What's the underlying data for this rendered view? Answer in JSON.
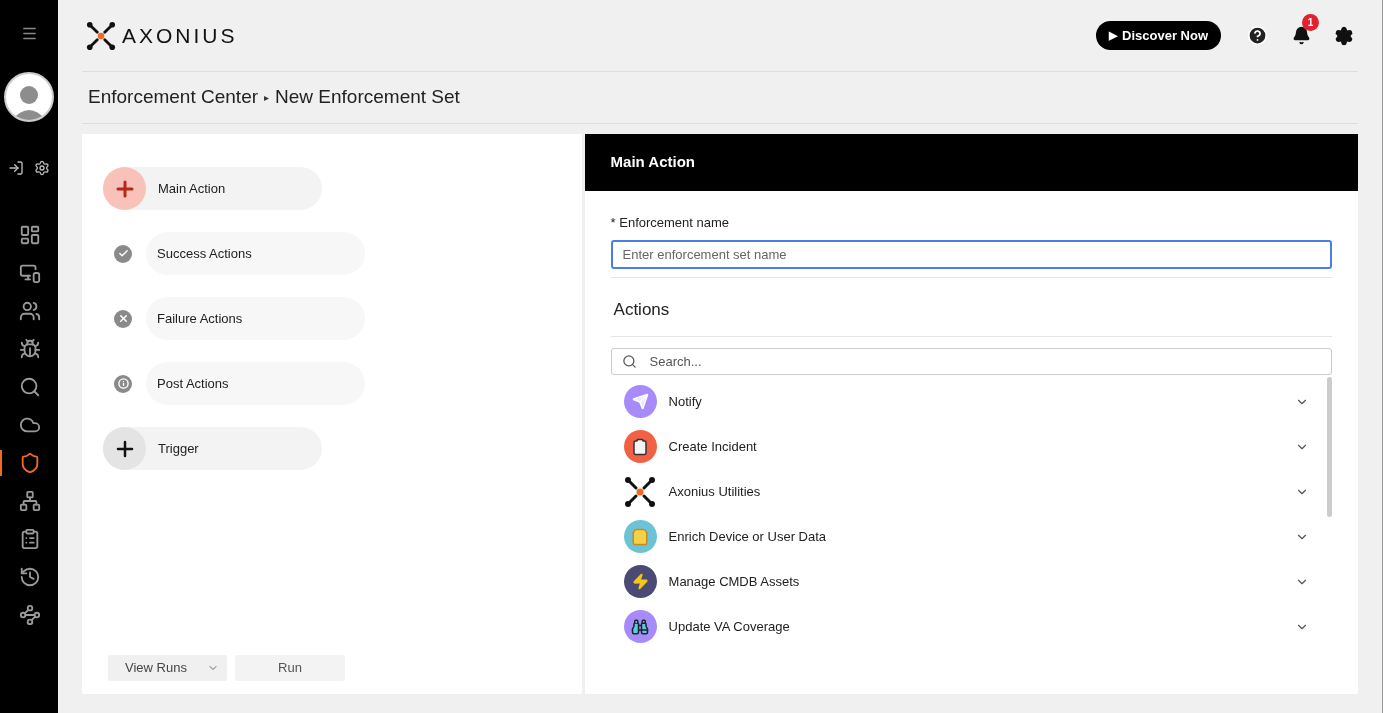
{
  "sidebar": {
    "nav": [
      {
        "selected": false
      },
      {
        "selected": false
      },
      {
        "selected": false
      },
      {
        "selected": false
      },
      {
        "selected": false
      },
      {
        "selected": false
      },
      {
        "selected": true
      },
      {
        "selected": false
      },
      {
        "selected": false
      },
      {
        "selected": false
      },
      {
        "selected": false
      }
    ]
  },
  "header": {
    "logo": "AXONIUS",
    "discover_button": "Discover Now",
    "play_glyph": "▶",
    "notification_count": "1"
  },
  "breadcrumb": {
    "parent": "Enforcement Center",
    "separator": "▸",
    "current": "New Enforcement Set"
  },
  "steps": [
    {
      "kind": "add",
      "label": "Main Action",
      "selected": true
    },
    {
      "kind": "success",
      "label": "Success Actions",
      "selected": false
    },
    {
      "kind": "failure",
      "label": "Failure Actions",
      "selected": false
    },
    {
      "kind": "info",
      "label": "Post Actions",
      "selected": false
    },
    {
      "kind": "add",
      "label": "Trigger",
      "selected": false
    }
  ],
  "footer_buttons": {
    "view_runs": "View Runs",
    "run": "Run"
  },
  "panel": {
    "title": "Main Action",
    "name_label": "* Enforcement name",
    "name_placeholder": "Enter enforcement set name",
    "actions_heading": "Actions",
    "search_placeholder": "Search...",
    "actions": [
      {
        "kind": "notify",
        "label": "Notify",
        "color": "#a78bfa"
      },
      {
        "kind": "incident",
        "label": "Create Incident",
        "color": "#f26143"
      },
      {
        "kind": "utilities",
        "label": "Axonius Utilities",
        "color": "#ffffff"
      },
      {
        "kind": "enrich",
        "label": "Enrich Device or User Data",
        "color": "#6cc3d5"
      },
      {
        "kind": "cmdb",
        "label": "Manage CMDB Assets",
        "color": "#4b4a75"
      },
      {
        "kind": "va",
        "label": "Update VA Coverage",
        "color": "#a78bfa"
      }
    ]
  }
}
